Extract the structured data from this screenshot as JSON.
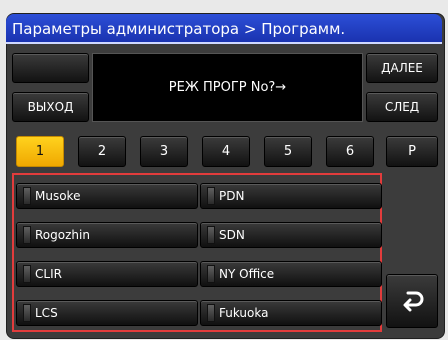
{
  "title": "Параметры администратора > Программ.",
  "display": {
    "text": "РЕЖ ПРОГР No?→"
  },
  "buttons": {
    "blank": "",
    "exit": "ВЫХОД",
    "next": "ДАЛЕЕ",
    "follow": "СЛЕД"
  },
  "tabs": [
    {
      "label": "1",
      "active": true
    },
    {
      "label": "2"
    },
    {
      "label": "3"
    },
    {
      "label": "4"
    },
    {
      "label": "5"
    },
    {
      "label": "6"
    },
    {
      "label": "P"
    }
  ],
  "entries": [
    {
      "label": "Musoke"
    },
    {
      "label": "PDN"
    },
    {
      "label": "Rogozhin"
    },
    {
      "label": "SDN"
    },
    {
      "label": "CLIR"
    },
    {
      "label": "NY Office"
    },
    {
      "label": "LCS"
    },
    {
      "label": "Fukuoka"
    }
  ],
  "icons": {
    "back": "return-arrow-icon"
  },
  "colors": {
    "title_bar": "#1f3fc8",
    "active_tab": "#f5b800",
    "highlight_border": "#e23c3c"
  }
}
